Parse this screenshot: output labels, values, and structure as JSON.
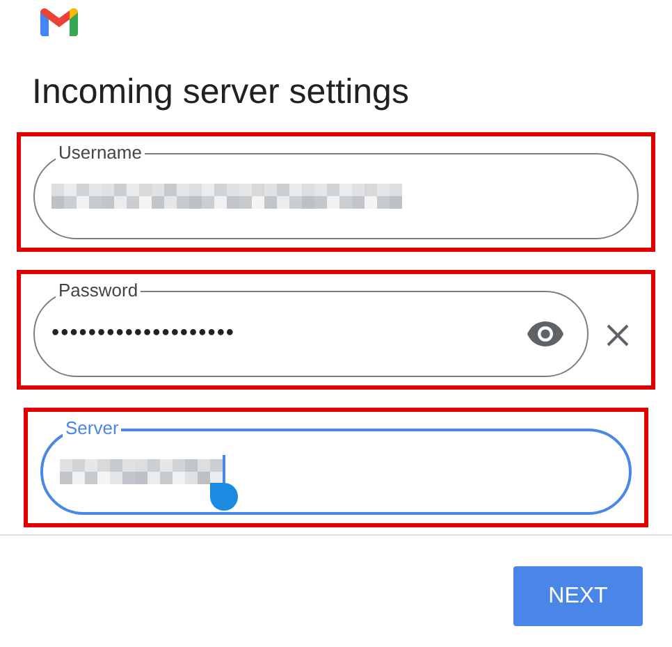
{
  "title": "Incoming server settings",
  "fields": [
    {
      "kind": "text",
      "label": "Username",
      "redacted": true,
      "focused": false
    },
    {
      "kind": "password",
      "label": "Password",
      "value": "••••••••••••••••••••",
      "focused": false
    },
    {
      "kind": "text",
      "label": "Server",
      "redacted": true,
      "focused": true
    }
  ],
  "buttons": [
    {
      "label": "NEXT"
    }
  ]
}
